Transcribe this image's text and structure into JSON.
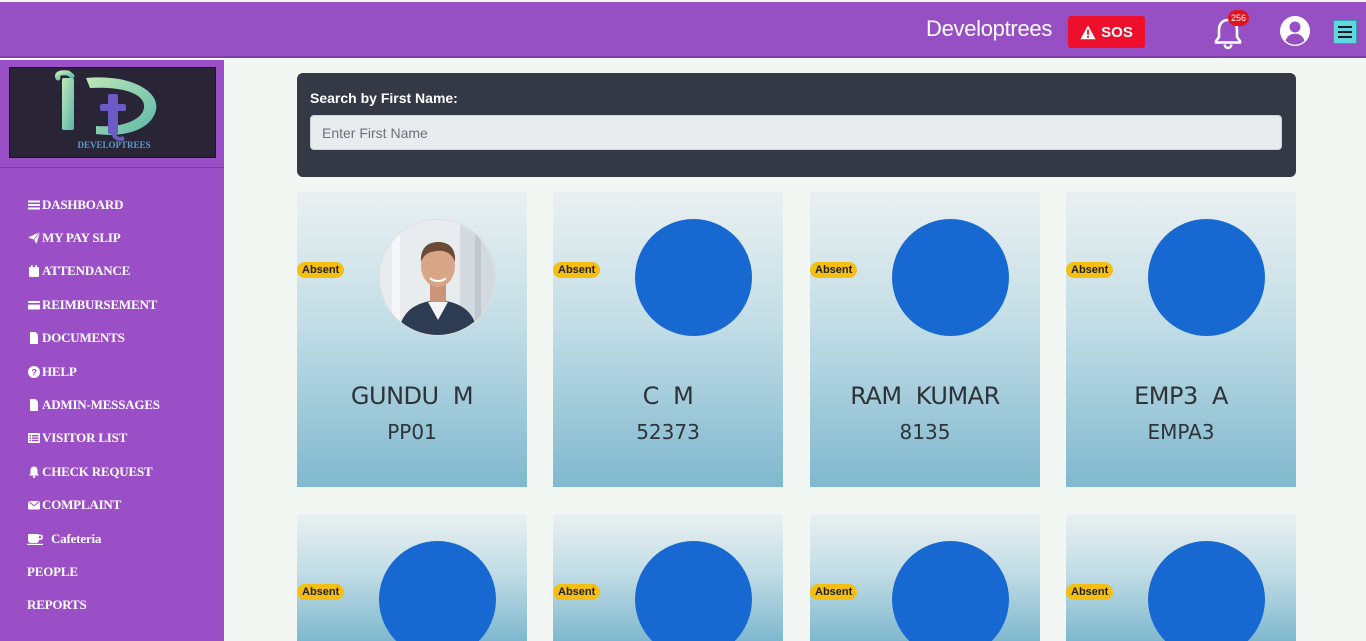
{
  "header": {
    "brand": "Developtrees",
    "sos_label": "SOS",
    "notification_count": "256",
    "colors": {
      "bar": "#9750c4",
      "sos": "#ee0f2d",
      "badge": "#e0131f"
    }
  },
  "sidebar": {
    "logo_text": "DEVELOPTREES",
    "items": [
      {
        "label": "DASHBOARD",
        "icon": "bars-icon"
      },
      {
        "label": "MY PAY SLIP",
        "icon": "paper-plane-icon"
      },
      {
        "label": "ATTENDANCE",
        "icon": "calendar-icon"
      },
      {
        "label": "REIMBURSEMENT",
        "icon": "credit-card-icon"
      },
      {
        "label": "DOCUMENTS",
        "icon": "file-icon"
      },
      {
        "label": "HELP",
        "icon": "question-circle-icon"
      },
      {
        "label": "ADMIN-MESSAGES",
        "icon": "file-icon"
      },
      {
        "label": "VISITOR LIST",
        "icon": "list-icon"
      },
      {
        "label": "CHECK REQUEST",
        "icon": "bell-icon"
      },
      {
        "label": "COMPLAINT",
        "icon": "envelope-icon"
      },
      {
        "label": "Cafeteria",
        "icon": "coffee-icon"
      },
      {
        "label": "PEOPLE",
        "icon": ""
      },
      {
        "label": "REPORTS",
        "icon": ""
      }
    ]
  },
  "search": {
    "label": "Search by First Name:",
    "placeholder": "Enter First Name",
    "value": ""
  },
  "employees": [
    {
      "name": "GUNDU  M",
      "code": "PP01",
      "status": "Absent",
      "has_photo": true
    },
    {
      "name": "C  M",
      "code": "52373",
      "status": "Absent",
      "has_photo": false
    },
    {
      "name": "RAM  KUMAR",
      "code": "8135",
      "status": "Absent",
      "has_photo": false
    },
    {
      "name": "EMP3  A",
      "code": "EMPA3",
      "status": "Absent",
      "has_photo": false
    },
    {
      "status": "Absent",
      "has_photo": false
    },
    {
      "status": "Absent",
      "has_photo": false
    },
    {
      "status": "Absent",
      "has_photo": false
    },
    {
      "status": "Absent",
      "has_photo": false
    }
  ]
}
